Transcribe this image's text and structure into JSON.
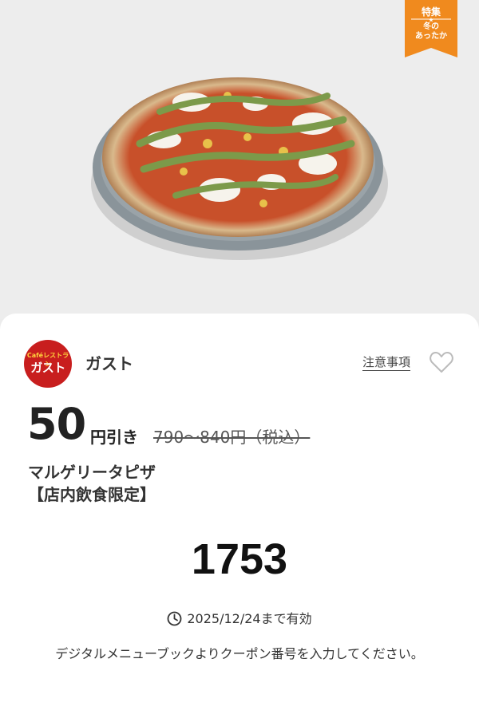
{
  "badge": {
    "top_label": "特集",
    "bottom_label": "冬の\nあったか",
    "color": "#f08a1e"
  },
  "hero": {
    "image": "pizza-photo"
  },
  "shop": {
    "logo_small": "Caféレストラン",
    "logo_main": "ガスト",
    "name": "ガスト",
    "notes_label": "注意事項",
    "favorite_icon": "heart-icon"
  },
  "offer": {
    "discount_value": "50",
    "discount_unit": "円引き",
    "original_price": "790〜840円（税込）",
    "product_name": "マルゲリータピザ",
    "product_tag": "【店内飲食限定】"
  },
  "coupon": {
    "code": "1753",
    "validity": "2025/12/24まで有効",
    "instructions": "デジタルメニューブックよりクーポン番号を入力してください。"
  }
}
